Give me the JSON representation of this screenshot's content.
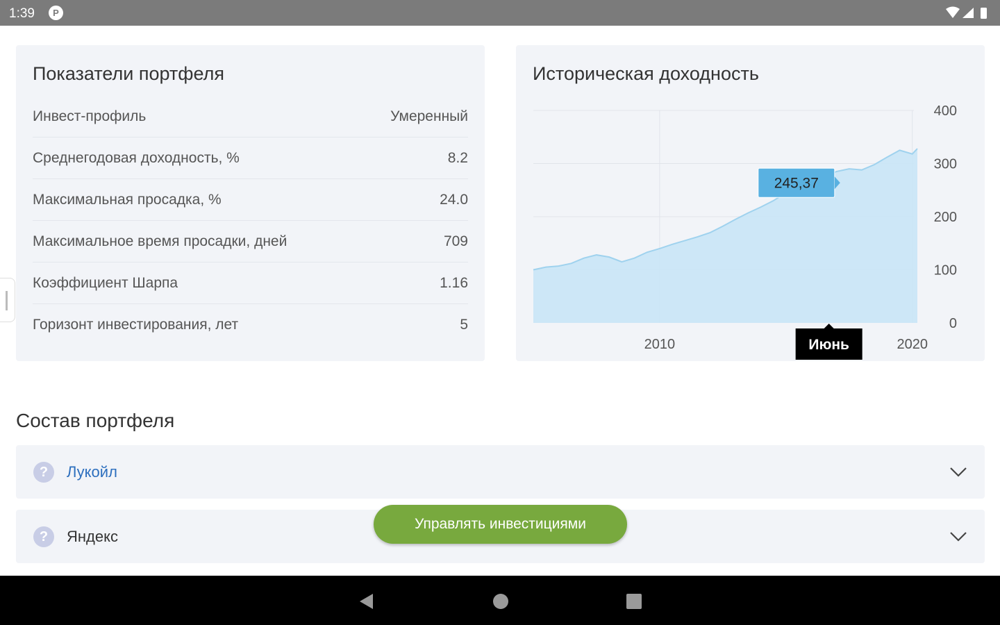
{
  "status_bar": {
    "time": "1:39",
    "app_icon": "P",
    "icons": [
      "wifi-icon",
      "signal-icon",
      "battery-icon"
    ]
  },
  "metrics": {
    "title": "Показатели портфеля",
    "rows": [
      {
        "label": "Инвест-профиль",
        "value": "Умеренный"
      },
      {
        "label": "Среднегодовая доходность, %",
        "value": "8.2"
      },
      {
        "label": "Максимальная просадка, %",
        "value": "24.0"
      },
      {
        "label": "Максимальное время просадки, дней",
        "value": "709"
      },
      {
        "label": "Коэффициент Шарпа",
        "value": "1.16"
      },
      {
        "label": "Горизонт инвестирования, лет",
        "value": "5"
      }
    ]
  },
  "history": {
    "title": "Историческая доходность",
    "tooltip_value": "245,37",
    "tooltip_label": "Июнь"
  },
  "chart_data": {
    "type": "area",
    "title": "Историческая доходность",
    "x": [
      2005.0,
      2005.5,
      2006.0,
      2006.5,
      2007.0,
      2007.5,
      2008.0,
      2008.5,
      2009.0,
      2009.5,
      2010.0,
      2010.5,
      2011.0,
      2011.5,
      2012.0,
      2012.5,
      2013.0,
      2013.5,
      2014.0,
      2014.5,
      2015.0,
      2015.5,
      2016.0,
      2016.5,
      2017.0,
      2017.5,
      2018.0,
      2018.5,
      2019.0,
      2019.5,
      2020.0,
      2020.2
    ],
    "y": [
      100,
      105,
      107,
      112,
      122,
      128,
      124,
      115,
      122,
      133,
      140,
      148,
      155,
      162,
      170,
      182,
      195,
      207,
      218,
      230,
      245,
      255,
      265,
      275,
      285,
      290,
      288,
      298,
      312,
      325,
      318,
      328
    ],
    "x_ticks": [
      "2010",
      "2020"
    ],
    "y_ticks": [
      "400",
      "300",
      "200",
      "100",
      "0"
    ],
    "xlim": [
      2005,
      2020.2
    ],
    "ylim": [
      0,
      400
    ],
    "grid": true,
    "fill_color": "#c9e6f6",
    "line_color": "#9fd2ee",
    "tooltip": {
      "x": 2015.0,
      "y": 245.37
    }
  },
  "composition": {
    "title": "Состав портфеля",
    "stocks": [
      {
        "name": "Лукойл"
      },
      {
        "name": "Яндекс"
      }
    ]
  },
  "manage_button": "Управлять инвестициями",
  "nav_bar": {
    "buttons": [
      "back-icon",
      "home-icon",
      "recents-icon"
    ]
  }
}
